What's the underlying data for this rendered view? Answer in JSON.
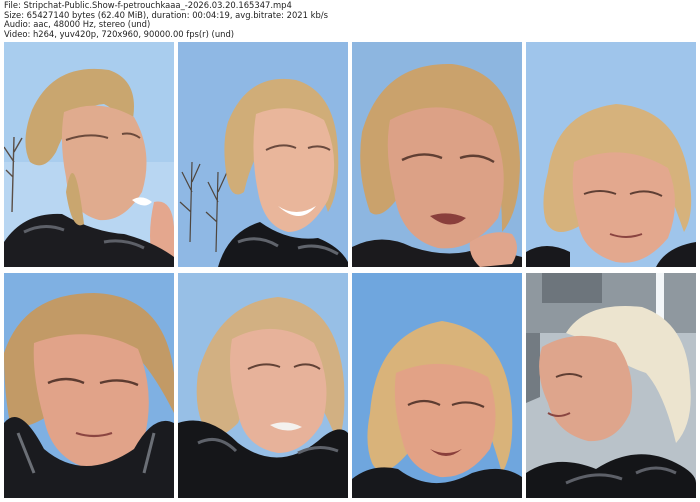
{
  "header": {
    "lines": [
      "File: Stripchat-Public.Show-f-petrouchkaaa_-2026.03.20.165347.mp4",
      "Size: 65427140 bytes (62.40 MiB), duration: 00:04:19, avg.bitrate: 2021 kb/s",
      "Audio: aac, 48000 Hz, stereo (und)",
      "Video: h264, yuv420p, 720x960, 90000.00 fps(r) (und)"
    ]
  },
  "thumbnails": [
    {
      "scene": "blue sky, bare tree, woman turned right, hand at chin",
      "sky": "#a9cdee"
    },
    {
      "scene": "blue sky, bare trees, woman smiling",
      "sky": "#8fb8e4"
    },
    {
      "scene": "close-up face, blue sky, hand raised",
      "sky": "#8db6e0"
    },
    {
      "scene": "blue sky, woman looking down",
      "sky": "#9fc5eb"
    },
    {
      "scene": "blue sky, woman squinting",
      "sky": "#7fb0e2"
    },
    {
      "scene": "blue sky, woman from below",
      "sky": "#97bfe6"
    },
    {
      "scene": "blue sky, woman looking down",
      "sky": "#6fa6de"
    },
    {
      "scene": "indoor ceiling, woman in profile",
      "sky": "#b9c2c9"
    }
  ]
}
